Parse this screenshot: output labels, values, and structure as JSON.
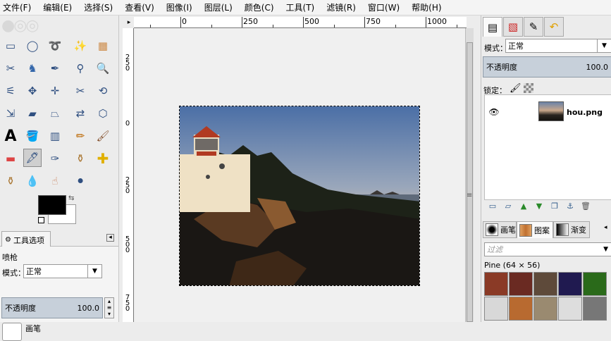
{
  "menu": [
    "文件(F)",
    "编辑(E)",
    "选择(S)",
    "查看(V)",
    "图像(I)",
    "图层(L)",
    "颜色(C)",
    "工具(T)",
    "滤镜(R)",
    "窗口(W)",
    "帮助(H)"
  ],
  "toolbox": {
    "tools": [
      "rect-select",
      "ellipse-select",
      "free-select",
      "fuzzy-select",
      "by-color-select",
      "scissors-select",
      "foreground-select",
      "paths",
      "color-picker",
      "zoom",
      "measure",
      "move",
      "align",
      "crop",
      "rotate",
      "scale",
      "shear",
      "perspective",
      "flip",
      "cage-transform",
      "text",
      "bucket-fill",
      "blend",
      "pencil",
      "paintbrush",
      "eraser",
      "airbrush",
      "ink",
      "clone",
      "heal",
      "blur",
      "smudge",
      "dodge-burn"
    ],
    "selected_tool": "airbrush",
    "fg_color": "#000000",
    "bg_color": "#ffffff"
  },
  "tool_options": {
    "tab_label": "工具选项",
    "tool_name": "喷枪",
    "mode_label": "模式：",
    "mode_value": "正常",
    "opacity_label": "不透明度",
    "opacity_value": "100.0",
    "brush_label": "画笔"
  },
  "rulers": {
    "h_labels": [
      "0",
      "250",
      "500",
      "750",
      "1000"
    ],
    "v_labels": [
      "2 5 0",
      "0",
      "2 5 0",
      "5 0 0",
      "7 5 0"
    ]
  },
  "layers": {
    "mode_label": "模式：",
    "mode_value": "正常",
    "opacity_label": "不透明度",
    "opacity_value": "100.0",
    "lock_label": "锁定：",
    "layer_name": "hou.png"
  },
  "brushes_panel": {
    "tabs": [
      "画笔",
      "图案",
      "渐变"
    ],
    "filter_placeholder": "过滤",
    "pattern_name": "Pine (64 × 56)"
  }
}
